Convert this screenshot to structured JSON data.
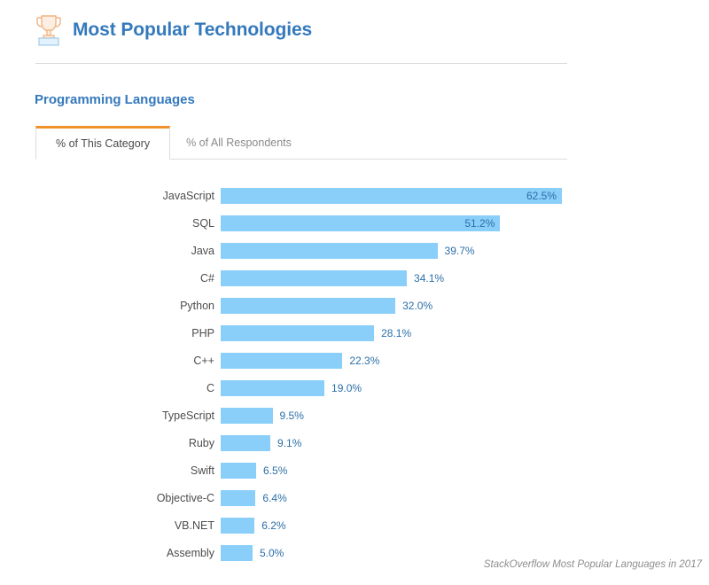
{
  "header": {
    "title": "Most Popular Technologies",
    "icon": "trophy-icon",
    "title_color": "#3479BC"
  },
  "section": {
    "title": "Programming Languages",
    "title_color": "#3479BC"
  },
  "tabs": [
    {
      "label": "% of This Category",
      "active": true
    },
    {
      "label": "% of All Respondents",
      "active": false
    }
  ],
  "tab_accent_color": "#F0922B",
  "caption": "StackOverflow Most Popular Languages in 2017",
  "chart_data": {
    "type": "bar",
    "orientation": "horizontal",
    "title": "Programming Languages",
    "xlabel": "",
    "ylabel": "",
    "xlim": [
      0,
      62.5
    ],
    "grid": false,
    "legend": false,
    "bar_color": "#8ACEFA",
    "value_color": "#2C6FA8",
    "value_suffix": "%",
    "categories": [
      "JavaScript",
      "SQL",
      "Java",
      "C#",
      "Python",
      "PHP",
      "C++",
      "C",
      "TypeScript",
      "Ruby",
      "Swift",
      "Objective-C",
      "VB.NET",
      "Assembly"
    ],
    "values": [
      62.5,
      51.2,
      39.7,
      34.1,
      32.0,
      28.1,
      22.3,
      19.0,
      9.5,
      9.1,
      6.5,
      6.4,
      6.2,
      5.0
    ],
    "labels": [
      "62.5%",
      "51.2%",
      "39.7%",
      "34.1%",
      "32.0%",
      "28.1%",
      "22.3%",
      "19.0%",
      "9.5%",
      "9.1%",
      "6.5%",
      "6.4%",
      "6.2%",
      "5.0%"
    ],
    "label_placement": [
      "inside",
      "inside",
      "outside",
      "outside",
      "outside",
      "outside",
      "outside",
      "outside",
      "outside",
      "outside",
      "outside",
      "outside",
      "outside",
      "outside"
    ]
  }
}
